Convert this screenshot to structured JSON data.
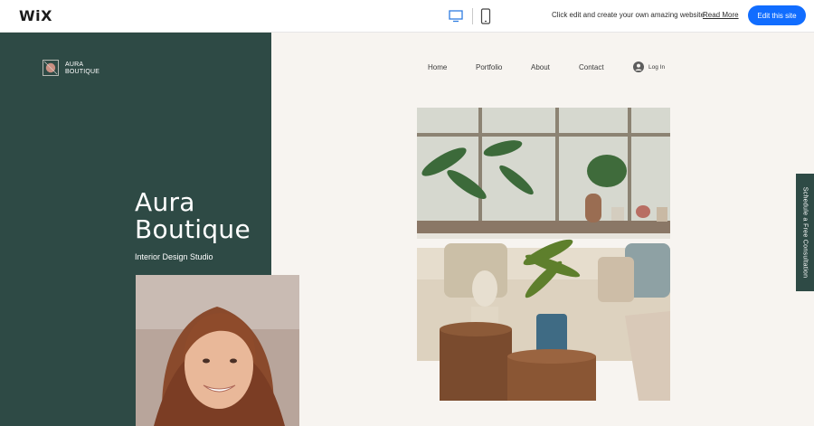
{
  "wix_bar": {
    "logo": "WiX",
    "promo_text": "Click edit and create your own amazing website",
    "read_more": "Read More",
    "edit_button": "Edit this site",
    "accent_color": "#116dff"
  },
  "site": {
    "brand_name": "AURA\nBOUTIQUE",
    "nav": [
      "Home",
      "Portfolio",
      "About",
      "Contact"
    ],
    "login_label": "Log In",
    "hero_title_line1": "Aura",
    "hero_title_line2": "Boutique",
    "hero_subtitle": "Interior Design Studio",
    "consult_tab": "Schedule a Free Consultation",
    "sidebar_color": "#2e4a45"
  }
}
